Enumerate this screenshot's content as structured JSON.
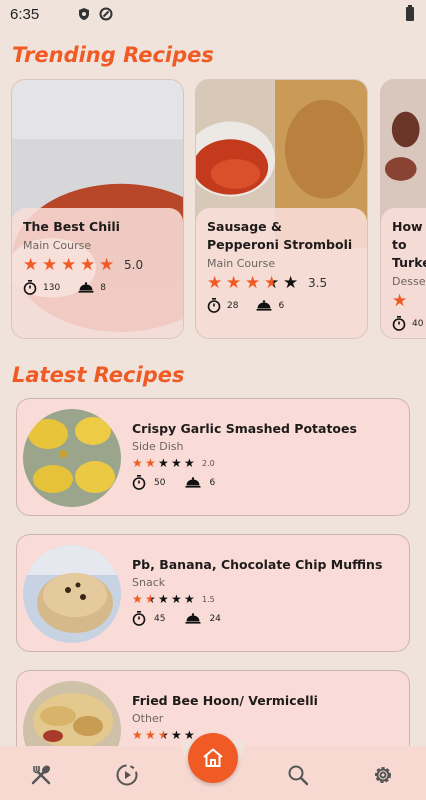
{
  "status_bar": {
    "time": "6:35"
  },
  "trending": {
    "title": "Trending Recipes",
    "cards": [
      {
        "title": "The Best Chili",
        "category": "Main Course",
        "rating": 5.0,
        "rating_text": "5.0",
        "time": "130",
        "servings": "8"
      },
      {
        "title": "Sausage & Pepperoni Stromboli",
        "category": "Main Course",
        "rating": 3.5,
        "rating_text": "3.5",
        "time": "28",
        "servings": "6"
      },
      {
        "title": "How to Turke",
        "category": "Desse",
        "rating": 1,
        "rating_text": "",
        "time": "40",
        "servings": ""
      }
    ]
  },
  "latest": {
    "title": "Latest Recipes",
    "items": [
      {
        "title": "Crispy Garlic Smashed Potatoes",
        "category": "Side Dish",
        "rating": 2.0,
        "rating_text": "2.0",
        "time": "50",
        "servings": "6"
      },
      {
        "title": "Pb, Banana, Chocolate Chip Muffins",
        "category": "Snack",
        "rating": 1.5,
        "rating_text": "1.5",
        "time": "45",
        "servings": "24"
      },
      {
        "title": "Fried Bee Hoon/ Vermicelli",
        "category": "Other",
        "rating": 2.5,
        "rating_text": "",
        "time": "",
        "servings": ""
      }
    ]
  },
  "nav": {
    "items": [
      "recipes-icon",
      "play-icon",
      "home-icon",
      "search-icon",
      "settings-icon"
    ]
  },
  "colors": {
    "accent": "#f05a24",
    "card_bg": "#f9dcd8",
    "page_bg": "#efe3db"
  }
}
